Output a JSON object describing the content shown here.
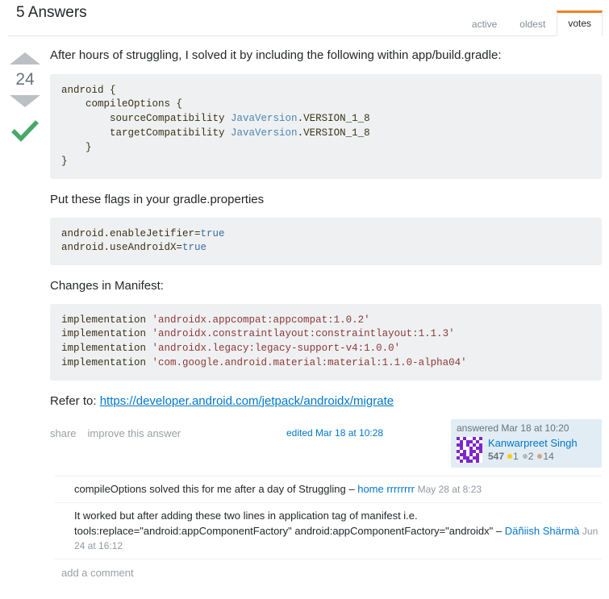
{
  "header": {
    "title": "5 Answers",
    "tabs": [
      {
        "label": "active",
        "active": false
      },
      {
        "label": "oldest",
        "active": false
      },
      {
        "label": "votes",
        "active": true
      }
    ]
  },
  "answer": {
    "vote_count": "24",
    "accepted": true,
    "intro_paragraph": "After hours of struggling, I solved it by including the following within app/build.gradle:",
    "code_block_1": {
      "line_1": "android {",
      "line_2": "    compileOptions {",
      "line_3_pre": "        sourceCompatibility ",
      "line_3_type": "JavaVersion",
      "line_3_post": ".VERSION_1_8",
      "line_4_pre": "        targetCompatibility ",
      "line_4_type": "JavaVersion",
      "line_4_post": ".VERSION_1_8",
      "line_5": "    }",
      "line_6": "}"
    },
    "paragraph_2": "Put these flags in your gradle.properties",
    "code_block_2": {
      "line_1_pre": "android.enableJetifier=",
      "line_1_kw": "true",
      "line_2_pre": "android.useAndroidX=",
      "line_2_kw": "true"
    },
    "paragraph_3": "Changes in Manifest:",
    "code_block_3": {
      "line_1_pre": "implementation ",
      "line_1_str": "'androidx.appcompat:appcompat:1.0.2'",
      "line_2_pre": "implementation ",
      "line_2_str": "'androidx.constraintlayout:constraintlayout:1.1.3'",
      "line_3_pre": "implementation ",
      "line_3_str": "'androidx.legacy:legacy-support-v4:1.0.0'",
      "line_4_pre": "implementation ",
      "line_4_str": "'com.google.android.material:material:1.1.0-alpha04'"
    },
    "refer_prefix": "Refer to: ",
    "refer_link_text": "https://developer.android.com/jetpack/androidx/migrate",
    "actions": {
      "share": "share",
      "improve": "improve this answer"
    },
    "edited_info": "edited Mar 18 at 10:28",
    "user_card": {
      "action_time": "answered Mar 18 at 10:20",
      "username": "Kanwarpreet Singh",
      "reputation": "547",
      "badges": [
        {
          "type": "gold",
          "count": "1"
        },
        {
          "type": "silver",
          "count": "2"
        },
        {
          "type": "bronze",
          "count": "14"
        }
      ]
    }
  },
  "comments": [
    {
      "text": "compileOptions solved this for me after a day of Struggling",
      "dash": "–",
      "user": "home rrrrrrrr",
      "date": "May 28 at 8:23"
    },
    {
      "text": "It worked but after adding these two lines in application tag of manifest i.e. tools:replace=\"android:appComponentFactory\" android:appComponentFactory=\"androidx\"",
      "dash": "–",
      "user": "Däñiish Shärmà",
      "date": "Jun 24 at 16:12"
    }
  ],
  "add_comment_label": "add a comment",
  "colors": {
    "accent_orange": "#f48024",
    "link_blue": "#0077cc",
    "accepted_green": "#48a868",
    "code_bg": "#eff0f1",
    "user_card_bg": "#e1ecf4"
  }
}
